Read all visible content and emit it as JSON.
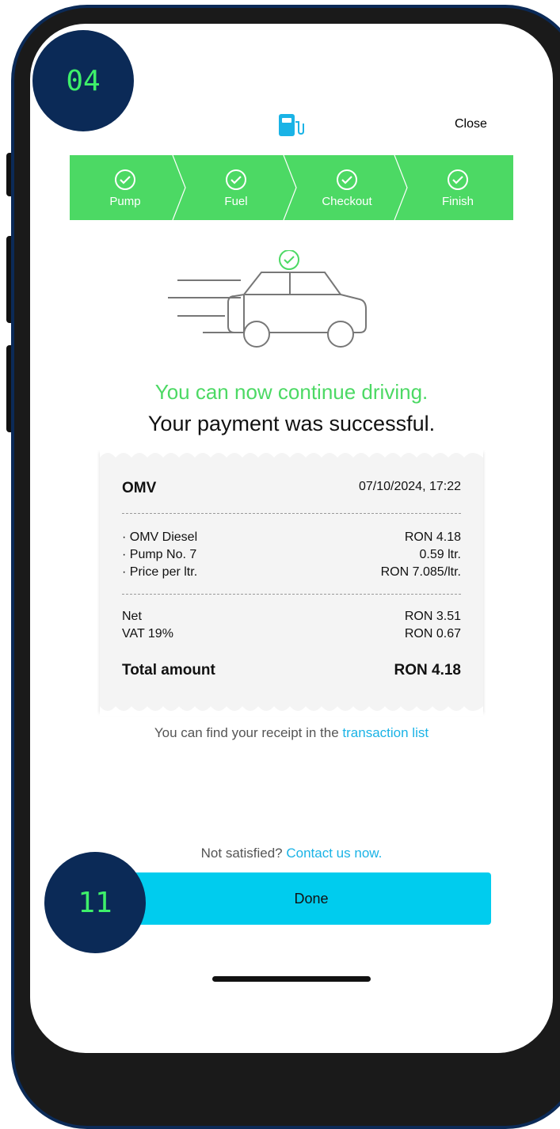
{
  "badges": {
    "top": "04",
    "bottom": "11"
  },
  "header": {
    "icon": "fuel-pump-icon",
    "close_label": "Close"
  },
  "steps": [
    {
      "label": "Pump",
      "status": "done"
    },
    {
      "label": "Fuel",
      "status": "done"
    },
    {
      "label": "Checkout",
      "status": "done"
    },
    {
      "label": "Finish",
      "status": "done"
    }
  ],
  "success": {
    "line1": "You can now continue driving.",
    "line2": "Your payment was successful."
  },
  "receipt": {
    "merchant": "OMV",
    "datetime": "07/10/2024, 17:22",
    "items": [
      {
        "label": "· OMV Diesel",
        "value": "RON 4.18"
      },
      {
        "label": "· Pump No. 7",
        "value": "0.59 ltr."
      },
      {
        "label": "· Price per ltr.",
        "value": "RON 7.085/ltr."
      }
    ],
    "net_label": "Net",
    "net_value": "RON 3.51",
    "vat_label": "VAT 19%",
    "vat_value": "RON 0.67",
    "total_label": "Total amount",
    "total_value": "RON 4.18"
  },
  "note": {
    "text": "You can find your receipt in the ",
    "link": "transaction list"
  },
  "support": {
    "text": "Not satisfied? ",
    "link": "Contact us now."
  },
  "done_label": "Done",
  "colors": {
    "brand_green": "#4cd964",
    "accent_cyan": "#00ccee",
    "link": "#1ab3e6",
    "badge_navy": "#0b2a57"
  }
}
